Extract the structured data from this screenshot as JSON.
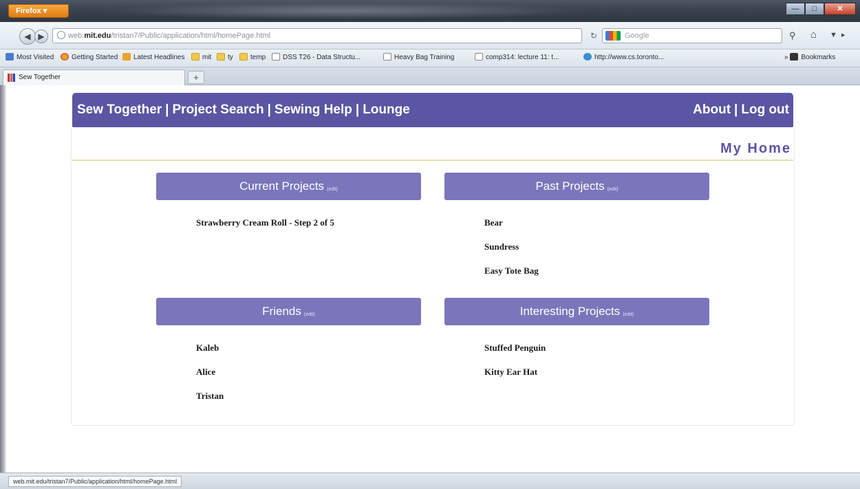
{
  "browser": {
    "app_button": "Firefox",
    "url_prefix": "web.",
    "url_domain": "mit.edu",
    "url_path": "/tristan7/Public/application/html/homePage.html",
    "search_placeholder": "Google",
    "bookmarks": [
      {
        "label": "Most Visited",
        "icon": "blue"
      },
      {
        "label": "Getting Started",
        "icon": "orange"
      },
      {
        "label": "Latest Headlines",
        "icon": "rss"
      },
      {
        "label": "mit",
        "icon": "folder"
      },
      {
        "label": "ty",
        "icon": "folder"
      },
      {
        "label": "temp",
        "icon": "folder"
      },
      {
        "label": "DSS T26 - Data Structu...",
        "icon": "page"
      },
      {
        "label": "Heavy Bag Training",
        "icon": "page"
      },
      {
        "label": "comp314: lecture 11: t...",
        "icon": "page"
      },
      {
        "label": "http://www.cs.toronto...",
        "icon": "tor"
      }
    ],
    "bookmarks_menu": "Bookmarks",
    "tab_title": "Sew Together",
    "status_url": "web.mit.edu/tristan7/Public/application/html/homePage.html"
  },
  "site": {
    "nav_left": [
      "Sew Together",
      "Project Search",
      "Sewing Help",
      "Lounge"
    ],
    "nav_right": [
      "About",
      "Log out"
    ],
    "separator": "|",
    "page_title": "My Home",
    "edit_label": "(edit)",
    "colors": {
      "header": "#5b55a3",
      "panel": "#7b75bb",
      "rule": "#ebdcaa"
    }
  },
  "panels": {
    "current_projects": {
      "title": "Current Projects",
      "items": [
        "Strawberry Cream Roll - Step 2 of 5"
      ]
    },
    "past_projects": {
      "title": "Past Projects",
      "items": [
        "Bear",
        "Sundress",
        "Easy Tote Bag"
      ]
    },
    "friends": {
      "title": "Friends",
      "items": [
        "Kaleb",
        "Alice",
        "Tristan"
      ]
    },
    "interesting_projects": {
      "title": "Interesting Projects",
      "items": [
        "Stuffed Penguin",
        "Kitty Ear Hat"
      ]
    }
  }
}
